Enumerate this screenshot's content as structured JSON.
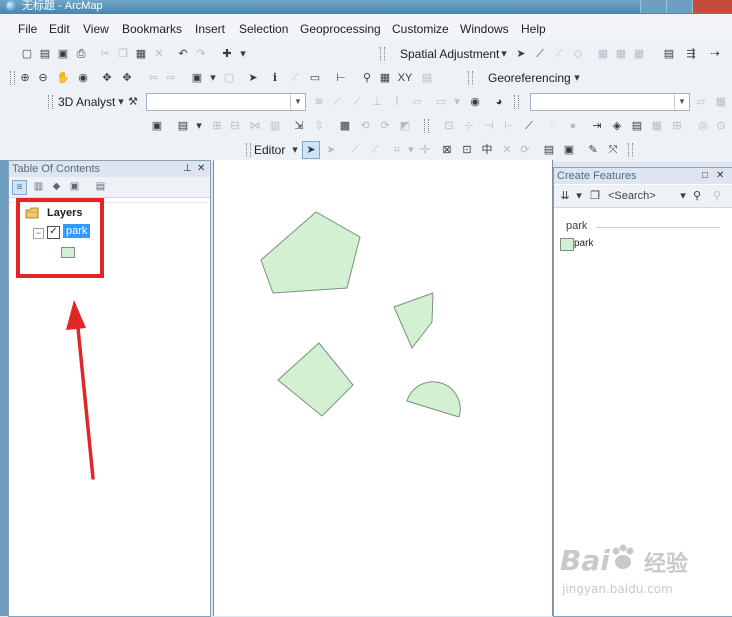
{
  "window": {
    "title": "无标题 - ArcMap"
  },
  "menu": [
    "File",
    "Edit",
    "View",
    "Bookmarks",
    "Insert",
    "Selection",
    "Geoprocessing",
    "Customize",
    "Windows",
    "Help"
  ],
  "toolbars": {
    "spatial_adjustment": "Spatial Adjustment",
    "georeferencing": "Georeferencing",
    "analyst_3d": "3D Analyst",
    "editor": "Editor"
  },
  "toc": {
    "title": "Table Of Contents",
    "root_group": "Layers",
    "layer_name": "park",
    "layer_checked": true
  },
  "create_features": {
    "title": "Create Features",
    "search_placeholder": "<Search>",
    "group_name": "park",
    "template_name": "park"
  },
  "map": {
    "feature_fill": "#d3f0d3",
    "feature_stroke": "#7c8f7c"
  },
  "colors": {
    "highlight": "#e02626",
    "selection": "#3399ff",
    "panel_title": "#dde6f0"
  },
  "watermark": {
    "brand": "Bai",
    "brand_cn": "经验",
    "url": "jingyan.baidu.com"
  }
}
